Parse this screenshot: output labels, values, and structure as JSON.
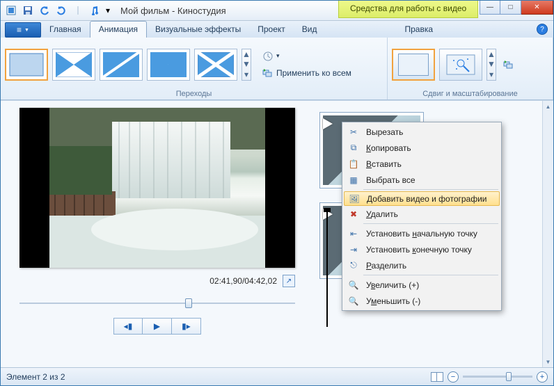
{
  "titlebar": {
    "title": "Мой фильм - Киностудия",
    "context_tab": "Средства для работы с видео"
  },
  "tabs": {
    "file_icon": "≡",
    "main": "Главная",
    "animation": "Анимация",
    "effects": "Визуальные эффекты",
    "project": "Проект",
    "view": "Вид",
    "edit": "Правка"
  },
  "ribbon": {
    "transitions_label": "Переходы",
    "apply_all": "Применить ко всем",
    "panzoom_label": "Сдвиг и масштабирование"
  },
  "preview": {
    "time": "02:41,90/04:42,02"
  },
  "context_menu": {
    "cut": "Вырезать",
    "copy": "Копировать",
    "paste": "Вставить",
    "select_all": "Выбрать все",
    "add_media": "Добавить видео и фотографии",
    "delete": "Удалить",
    "set_start": "Установить начальную точку",
    "set_end": "Установить конечную точку",
    "split": "Разделить",
    "zoom_in": "Увеличить (+)",
    "zoom_out": "Уменьшить (-)"
  },
  "statusbar": {
    "item_count": "Элемент 2 из 2"
  },
  "win_controls": {
    "min": "—",
    "max": "□",
    "close": "✕"
  }
}
